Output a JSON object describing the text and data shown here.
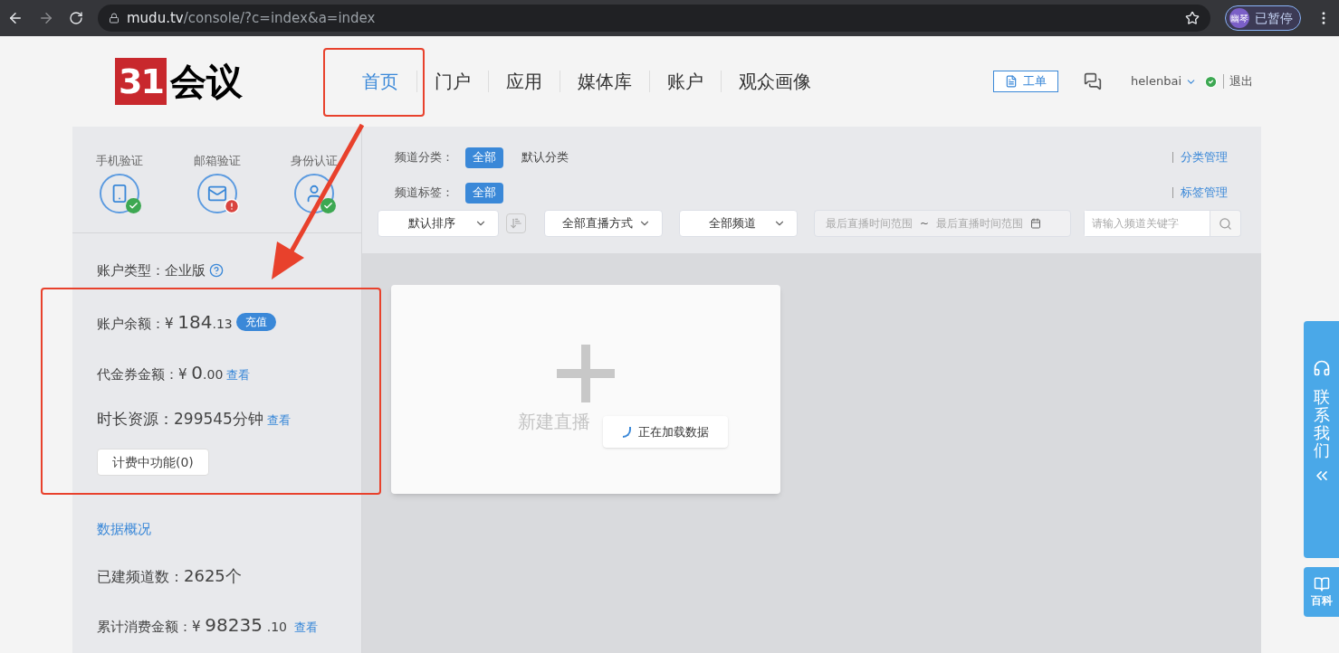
{
  "browser": {
    "url_host": "mudu.tv",
    "url_path": "/console/?c=index&a=index",
    "profile_avatar": "幽琴",
    "profile_status": "已暂停"
  },
  "header": {
    "logo_badge": "31",
    "logo_text": "会议",
    "nav": [
      {
        "label": "首页",
        "selected": true
      },
      {
        "label": "门户",
        "selected": false
      },
      {
        "label": "应用",
        "selected": false
      },
      {
        "label": "媒体库",
        "selected": false
      },
      {
        "label": "账户",
        "selected": false
      },
      {
        "label": "观众画像",
        "selected": false
      }
    ],
    "work_order": "工单",
    "user": "helenbai",
    "logout": "退出"
  },
  "verification": [
    {
      "label": "手机验证",
      "kind": "phone",
      "verified": true
    },
    {
      "label": "邮箱验证",
      "kind": "mail",
      "verified": false
    },
    {
      "label": "身份认证",
      "kind": "person",
      "verified": true
    }
  ],
  "account": {
    "type_label": "账户类型：",
    "type_value": "企业版",
    "balance_label": "账户余额：",
    "balance_currency": "¥",
    "balance_integer": "184",
    "balance_decimal": ".13",
    "recharge": "充值",
    "voucher_label": "代金券金额：",
    "voucher_currency": "¥",
    "voucher_integer": "0",
    "voucher_decimal": ".00",
    "voucher_view": "查看",
    "duration_label": "时长资源：",
    "duration_value": "299545分钟",
    "duration_view": "查看",
    "billing_button": "计费中功能(0)"
  },
  "stats": {
    "title": "数据概况",
    "channels_label": "已建频道数：",
    "channels_value": "2625个",
    "spend_label": "累计消费金额：",
    "spend_currency": "¥",
    "spend_integer": "98235",
    "spend_decimal": ".10",
    "spend_view": "查看"
  },
  "filters": [
    {
      "label": "频道分类：",
      "options": [
        {
          "label": "全部",
          "selected": true
        },
        {
          "label": "默认分类",
          "selected": false
        }
      ],
      "manage": "分类管理"
    },
    {
      "label": "频道标签：",
      "options": [
        {
          "label": "全部",
          "selected": true
        }
      ],
      "manage": "标签管理"
    }
  ],
  "toolbar": {
    "sort": "默认排序",
    "mode": "全部直播方式",
    "channel": "全部频道",
    "date_start": "最后直播时间范围",
    "date_separator": "~",
    "date_end": "最后直播时间范围",
    "search_placeholder": "请输入频道关键字"
  },
  "card": {
    "title": "新建直播",
    "loading": "正在加载数据"
  },
  "side_tabs": {
    "contact": "联系我们",
    "wiki": "百科"
  }
}
